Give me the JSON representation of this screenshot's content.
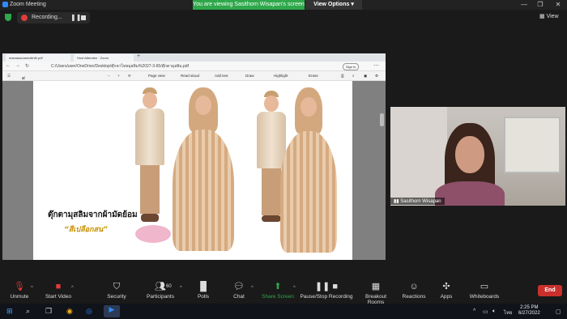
{
  "window": {
    "title": "Zoom Meeting",
    "banner": "You are viewing Sasithorn Wisapan's screen",
    "view_options": "View Options",
    "view_label": "View"
  },
  "recording": {
    "label": "Recording..."
  },
  "browser": {
    "tabs": [
      "mamasa/oamulkhfh.pdf",
      "Host Attendee · Zoom"
    ],
    "url": "C:/Users/user/OneDrive/Desktop/ตุ๊กตาไทยมุสลิม%2027-3-65/ตุ๊กตามุสลิม.pdf",
    "signin": "Sign in",
    "page_num": "1",
    "page_total": "of 8",
    "toolbar": [
      "Page view",
      "Read aloud",
      "Add text",
      "Draw",
      "Highlight",
      "Erase"
    ]
  },
  "document": {
    "title": "ตุ๊กตามุสลิมจากผ้ามัดย้อม",
    "subtitle": "“สีเปลือกสน”"
  },
  "video": {
    "participant_name": "Sasithorn Wisapan"
  },
  "toolbar": {
    "unmute": "Unmute",
    "start_video": "Start Video",
    "security": "Security",
    "participants": "Participants",
    "participants_count": "60",
    "polls": "Polls",
    "chat": "Chat",
    "share_screen": "Share Screen",
    "pause_stop_recording": "Pause/Stop Recording",
    "breakout_rooms": "Breakout Rooms",
    "reactions": "Reactions",
    "apps": "Apps",
    "whiteboards": "Whiteboards",
    "end": "End"
  },
  "taskbar": {
    "time": "2:25 PM",
    "date": "6/27/2022",
    "lang": "ไทย"
  },
  "colors": {
    "banner_green": "#2ea84a",
    "share_green": "#2ea84a",
    "end_red": "#c9302c",
    "record_red": "#e23b3b"
  }
}
